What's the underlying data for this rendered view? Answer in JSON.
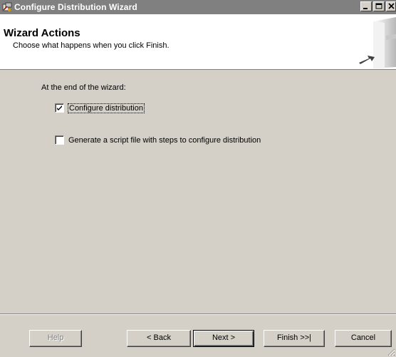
{
  "window": {
    "title": "Configure Distribution Wizard",
    "controls": {
      "minimize": "_",
      "maximize": "□",
      "close": "×"
    }
  },
  "header": {
    "title": "Wizard Actions",
    "subtitle": "Choose what happens when you click Finish."
  },
  "body": {
    "intro": "At the end of the wizard:",
    "options": [
      {
        "label": "Configure distribution",
        "checked": true
      },
      {
        "label": "Generate a script file with steps to configure distribution",
        "checked": false
      }
    ]
  },
  "buttons": {
    "help": "Help",
    "back": "< Back",
    "next": "Next >",
    "finish": "Finish >>|",
    "cancel": "Cancel"
  },
  "colors": {
    "titlebar": "#808080",
    "face": "#d4d0c8",
    "header_bg": "#ffffff"
  }
}
